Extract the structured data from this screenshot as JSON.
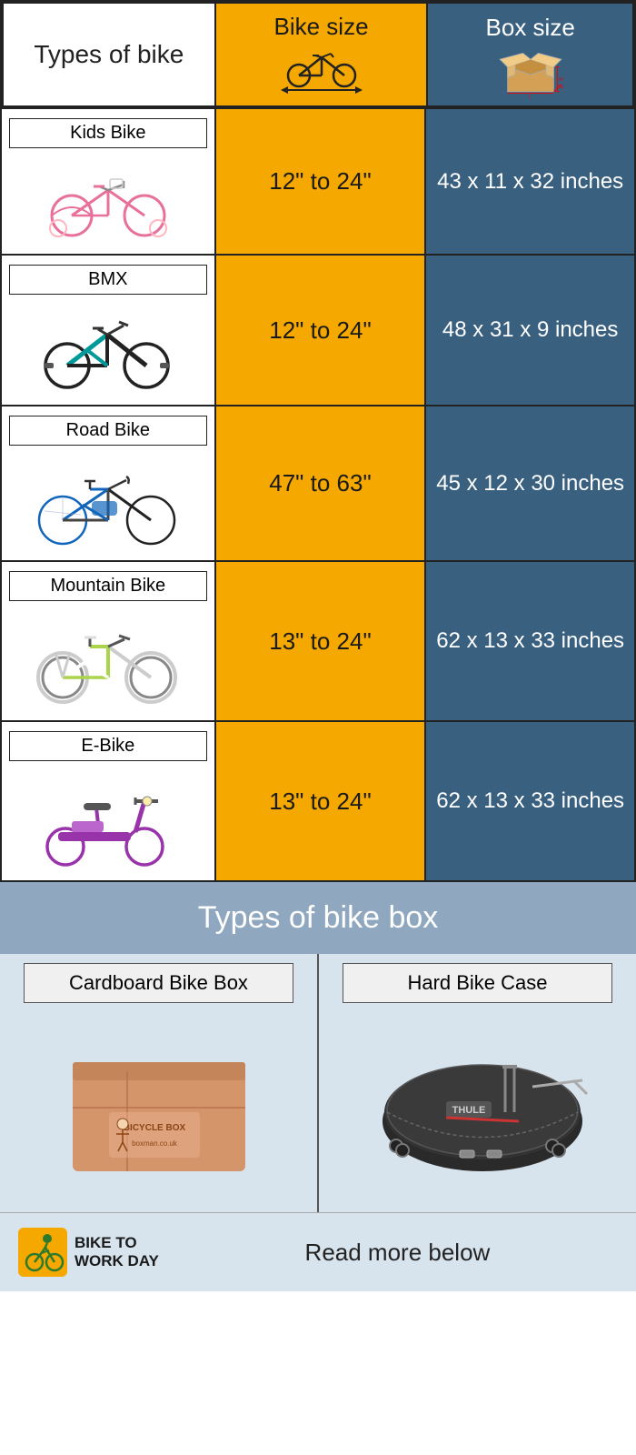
{
  "header": {
    "col1_title": "Types of bike",
    "col2_title": "Bike size",
    "col3_title": "Box size"
  },
  "rows": [
    {
      "type": "Kids Bike",
      "size": "12\" to 24\"",
      "box": "43 x 11 x 32 inches",
      "bike_color": "pink"
    },
    {
      "type": "BMX",
      "size": "12\" to 24\"",
      "box": "48 x 31 x 9 inches",
      "bike_color": "black_teal"
    },
    {
      "type": "Road Bike",
      "size": "47\" to 63\"",
      "box": "45 x 12 x 30 inches",
      "bike_color": "blue_black"
    },
    {
      "type": "Mountain Bike",
      "size": "13\" to 24\"",
      "box": "62 x 13 x 33 inches",
      "bike_color": "white_green"
    },
    {
      "type": "E-Bike",
      "size": "13\" to 24\"",
      "box": "62 x 13 x 33 inches",
      "bike_color": "purple"
    }
  ],
  "bottom": {
    "section_title": "Types of bike box",
    "col1_label": "Cardboard Bike Box",
    "col2_label": "Hard Bike Case"
  },
  "footer": {
    "logo_text": "BIKE TO\nWORK DAY",
    "read_more": "Read more below"
  }
}
